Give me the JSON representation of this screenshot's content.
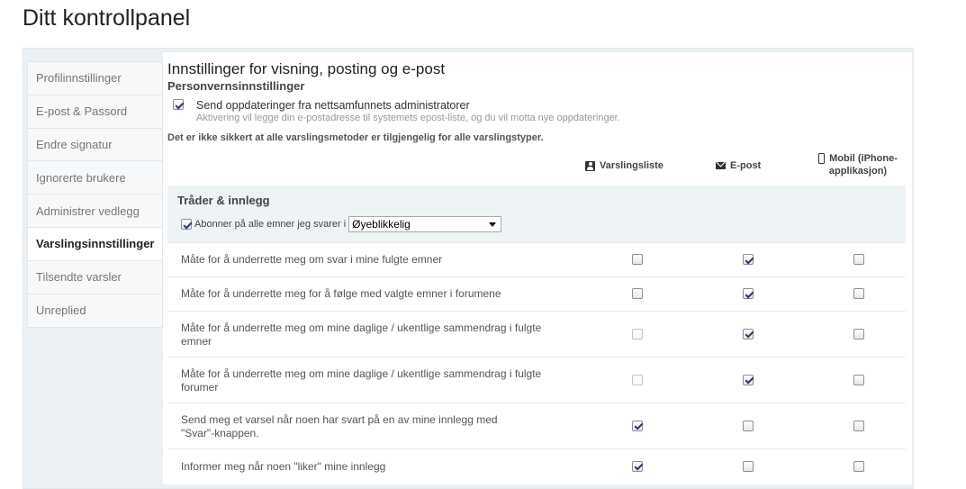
{
  "page_title": "Ditt kontrollpanel",
  "sidebar": {
    "items": [
      {
        "label": "Profilinnstillinger",
        "active": false
      },
      {
        "label": "E-post & Passord",
        "active": false
      },
      {
        "label": "Endre signatur",
        "active": false
      },
      {
        "label": "Ignorerte brukere",
        "active": false
      },
      {
        "label": "Administrer vedlegg",
        "active": false
      },
      {
        "label": "Varslingsinnstillinger",
        "active": true
      },
      {
        "label": "Tilsendte varsler",
        "active": false
      },
      {
        "label": "Unreplied",
        "active": false
      }
    ]
  },
  "content": {
    "title": "Innstillinger for visning, posting og e-post",
    "subtitle": "Personvernsinnstillinger",
    "admin_updates": {
      "label": "Send oppdateringer fra nettsamfunnets administratorer",
      "description": "Aktivering vil legge din e-postadresse til systemets epost-liste, og du vil motta nye oppdateringer.",
      "checked": true
    },
    "notice": "Det er ikke sikkert at alle varslingsmetoder er tilgjengelig for alle varslingstyper.",
    "columns": {
      "list": "Varslingsliste",
      "email": "E-post",
      "mobile_line1": "Mobil (iPhone-",
      "mobile_line2": "applikasjon)"
    },
    "section": {
      "title": "Tråder & innlegg",
      "subscribe_label": "Abonner på alle emner jeg svarer i",
      "subscribe_checked": true,
      "frequency": "Øyeblikkelig"
    },
    "rows": [
      {
        "line1": "Måte for å underrette meg om svar i mine fulgte emner",
        "line2": "",
        "list": "off",
        "email": "on",
        "mobile": "off"
      },
      {
        "line1": "Måte for å underrette meg for å følge med valgte emner i forumene",
        "line2": "",
        "list": "off",
        "email": "on",
        "mobile": "off"
      },
      {
        "line1": "Måte for å underrette meg om mine daglige / ukentlige sammendrag i fulgte",
        "line2": "emner",
        "list": "faded",
        "email": "on",
        "mobile": "off"
      },
      {
        "line1": "Måte for å underrette meg om mine daglige / ukentlige sammendrag i fulgte",
        "line2": "forumer",
        "list": "faded",
        "email": "on",
        "mobile": "off"
      },
      {
        "line1": "Send meg et varsel når noen har svart på en av mine innlegg med",
        "line2": "\"Svar\"-knappen.",
        "list": "on",
        "email": "off",
        "mobile": "off"
      },
      {
        "line1": "Informer meg når noen \"liker\" mine innlegg",
        "line2": "",
        "list": "on",
        "email": "off",
        "mobile": "off"
      }
    ]
  }
}
